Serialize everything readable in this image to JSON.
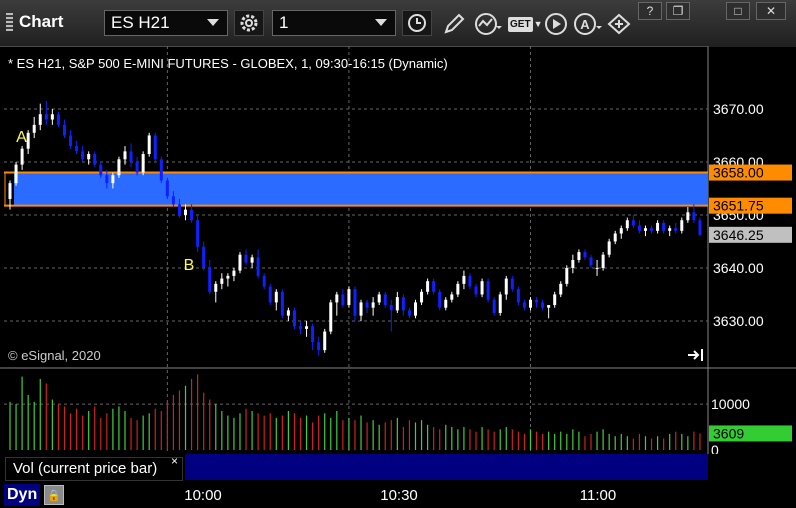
{
  "toolbar": {
    "title": "Chart",
    "symbol": "ES H21",
    "interval": "1",
    "icons": [
      "settings-gear-icon",
      "clock-icon",
      "pencil-icon",
      "study-icon",
      "get-icon",
      "play-icon",
      "analyst-icon",
      "dom-icon"
    ],
    "get_label": "GET",
    "window_buttons": [
      "link-icon",
      "restore-icon",
      "maximize-icon",
      "close-icon"
    ]
  },
  "chart_header": "* ES H21, S&P 500 E-MINI FUTURES - GLOBEX, 1, 09:30-16:15 (Dynamic)",
  "copyright": "© eSignal, 2020",
  "annotations": {
    "a": "A",
    "b": "B"
  },
  "price_axis": {
    "ticks": [
      "3670.00",
      "3660.00",
      "3650.00",
      "3640.00",
      "3630.00"
    ],
    "tick_values": [
      3670,
      3660,
      3650,
      3640,
      3630
    ],
    "markers": [
      {
        "label": "3658.00",
        "value": 3658.0,
        "color": "#ff8c00"
      },
      {
        "label": "3651.75",
        "value": 3651.75,
        "color": "#ff8c00"
      },
      {
        "label": "3646.25",
        "value": 3646.25,
        "color": "#c0c0c0"
      }
    ]
  },
  "zone": {
    "top": 3658.0,
    "bottom": 3651.75,
    "fill": "#2b6bff",
    "border": "#ff8c00"
  },
  "volume_axis": {
    "ticks": [
      "10000",
      "0"
    ],
    "tick_values": [
      10000,
      0
    ],
    "marker": {
      "label": "3609",
      "value": 3609,
      "color": "#33cc33"
    }
  },
  "vol_pane_label": "Vol (current price bar)",
  "vol_close": "×",
  "time_axis": {
    "ticks": [
      "10:00",
      "10:30",
      "11:00"
    ]
  },
  "bottom": {
    "dyn_label": "Dyn"
  },
  "colors": {
    "up": "#ffffff",
    "down": "#1020ff",
    "vol_up": "#44cc44",
    "vol_down": "#cc2222",
    "grid": "#666666"
  },
  "chart_data": {
    "type": "candlestick",
    "title": "* ES H21, S&P 500 E-MINI FUTURES - GLOBEX, 1, 09:30-16:15 (Dynamic)",
    "first_bar_time": "09:30",
    "interval_minutes": 1,
    "price_range": [
      3621.5,
      3681.5
    ],
    "volume_range": [
      0,
      17000
    ],
    "bars": [
      [
        3653.0,
        3656.5,
        3651.0,
        3656.0
      ],
      [
        3656.0,
        3660.0,
        3655.5,
        3659.5
      ],
      [
        3659.5,
        3663.0,
        3658.5,
        3662.5
      ],
      [
        3662.5,
        3666.0,
        3661.5,
        3665.5
      ],
      [
        3665.5,
        3668.5,
        3664.5,
        3667.0
      ],
      [
        3667.0,
        3671.0,
        3666.0,
        3669.0
      ],
      [
        3669.0,
        3671.5,
        3667.0,
        3668.0
      ],
      [
        3668.0,
        3670.0,
        3667.0,
        3669.0
      ],
      [
        3669.0,
        3669.5,
        3666.5,
        3667.0
      ],
      [
        3667.0,
        3668.0,
        3664.5,
        3665.0
      ],
      [
        3665.0,
        3666.0,
        3662.5,
        3663.0
      ],
      [
        3663.0,
        3664.0,
        3661.5,
        3662.0
      ],
      [
        3662.0,
        3663.0,
        3660.0,
        3660.5
      ],
      [
        3660.5,
        3662.0,
        3659.5,
        3661.5
      ],
      [
        3661.5,
        3662.0,
        3659.0,
        3659.5
      ],
      [
        3659.5,
        3660.0,
        3657.0,
        3657.5
      ],
      [
        3657.5,
        3658.5,
        3655.0,
        3656.0
      ],
      [
        3656.0,
        3658.0,
        3655.0,
        3657.5
      ],
      [
        3657.5,
        3661.0,
        3657.0,
        3660.5
      ],
      [
        3660.5,
        3663.0,
        3659.5,
        3662.0
      ],
      [
        3662.0,
        3663.5,
        3659.0,
        3660.0
      ],
      [
        3660.0,
        3661.0,
        3657.5,
        3658.0
      ],
      [
        3658.0,
        3662.0,
        3657.5,
        3661.5
      ],
      [
        3661.5,
        3665.5,
        3661.0,
        3665.0
      ],
      [
        3665.0,
        3665.5,
        3660.0,
        3660.5
      ],
      [
        3660.5,
        3661.0,
        3656.0,
        3656.5
      ],
      [
        3656.5,
        3657.0,
        3653.0,
        3653.5
      ],
      [
        3653.5,
        3654.5,
        3651.5,
        3652.0
      ],
      [
        3652.0,
        3653.0,
        3649.5,
        3650.0
      ],
      [
        3650.0,
        3652.0,
        3649.0,
        3651.0
      ],
      [
        3651.0,
        3652.0,
        3648.5,
        3649.0
      ],
      [
        3649.0,
        3650.0,
        3643.0,
        3644.0
      ],
      [
        3644.0,
        3645.0,
        3639.5,
        3640.0
      ],
      [
        3640.0,
        3641.5,
        3635.0,
        3635.5
      ],
      [
        3635.5,
        3637.5,
        3633.5,
        3637.0
      ],
      [
        3637.0,
        3639.0,
        3636.0,
        3638.0
      ],
      [
        3638.0,
        3639.0,
        3636.5,
        3638.5
      ],
      [
        3638.5,
        3640.0,
        3637.5,
        3639.5
      ],
      [
        3639.5,
        3643.0,
        3639.0,
        3642.5
      ],
      [
        3642.5,
        3643.5,
        3640.5,
        3641.0
      ],
      [
        3641.0,
        3642.5,
        3640.0,
        3642.0
      ],
      [
        3642.0,
        3643.5,
        3638.0,
        3638.5
      ],
      [
        3638.5,
        3639.0,
        3636.0,
        3636.5
      ],
      [
        3636.5,
        3637.0,
        3633.0,
        3633.5
      ],
      [
        3633.5,
        3636.0,
        3632.0,
        3635.5
      ],
      [
        3635.5,
        3636.0,
        3630.5,
        3631.0
      ],
      [
        3631.0,
        3632.5,
        3630.0,
        3632.0
      ],
      [
        3632.0,
        3632.5,
        3628.5,
        3629.0
      ],
      [
        3629.0,
        3630.0,
        3627.5,
        3628.5
      ],
      [
        3628.5,
        3630.0,
        3627.0,
        3629.0
      ],
      [
        3629.0,
        3629.5,
        3624.5,
        3626.0
      ],
      [
        3626.0,
        3627.0,
        3623.5,
        3624.5
      ],
      [
        3624.5,
        3628.5,
        3624.0,
        3628.0
      ],
      [
        3628.0,
        3634.0,
        3627.5,
        3633.5
      ],
      [
        3633.5,
        3635.5,
        3631.0,
        3635.0
      ],
      [
        3635.0,
        3636.0,
        3632.5,
        3633.0
      ],
      [
        3633.0,
        3636.5,
        3632.5,
        3636.0
      ],
      [
        3636.0,
        3636.5,
        3630.0,
        3631.0
      ],
      [
        3631.0,
        3634.0,
        3630.0,
        3633.5
      ],
      [
        3633.5,
        3634.0,
        3631.5,
        3632.5
      ],
      [
        3632.5,
        3634.5,
        3631.0,
        3633.5
      ],
      [
        3633.5,
        3635.5,
        3633.0,
        3635.0
      ],
      [
        3635.0,
        3635.5,
        3632.5,
        3633.0
      ],
      [
        3633.0,
        3634.0,
        3628.0,
        3632.0
      ],
      [
        3632.0,
        3635.5,
        3631.5,
        3634.5
      ],
      [
        3634.5,
        3635.0,
        3631.0,
        3632.0
      ],
      [
        3632.0,
        3632.5,
        3630.5,
        3631.0
      ],
      [
        3631.0,
        3634.0,
        3630.5,
        3633.5
      ],
      [
        3633.5,
        3636.0,
        3633.0,
        3635.5
      ],
      [
        3635.5,
        3638.0,
        3635.0,
        3637.5
      ],
      [
        3637.5,
        3638.0,
        3635.0,
        3635.5
      ],
      [
        3635.5,
        3636.0,
        3632.0,
        3632.5
      ],
      [
        3632.5,
        3634.5,
        3632.0,
        3634.0
      ],
      [
        3634.0,
        3635.5,
        3633.5,
        3635.0
      ],
      [
        3635.0,
        3637.5,
        3634.5,
        3637.0
      ],
      [
        3637.0,
        3639.5,
        3636.0,
        3638.5
      ],
      [
        3638.5,
        3639.0,
        3636.0,
        3636.5
      ],
      [
        3636.5,
        3637.0,
        3634.5,
        3635.0
      ],
      [
        3635.0,
        3638.0,
        3634.5,
        3637.5
      ],
      [
        3637.5,
        3638.0,
        3633.5,
        3634.0
      ],
      [
        3634.0,
        3634.5,
        3631.0,
        3631.5
      ],
      [
        3631.5,
        3635.5,
        3631.0,
        3635.0
      ],
      [
        3635.0,
        3638.5,
        3634.0,
        3638.0
      ],
      [
        3638.0,
        3638.5,
        3635.5,
        3636.0
      ],
      [
        3636.0,
        3636.5,
        3633.0,
        3633.5
      ],
      [
        3633.5,
        3634.0,
        3632.0,
        3632.5
      ],
      [
        3632.5,
        3634.5,
        3632.0,
        3634.0
      ],
      [
        3634.0,
        3634.5,
        3632.5,
        3633.5
      ],
      [
        3633.5,
        3634.0,
        3632.0,
        3632.5
      ],
      [
        3632.5,
        3633.0,
        3630.5,
        3633.0
      ],
      [
        3633.0,
        3635.5,
        3632.5,
        3635.0
      ],
      [
        3635.0,
        3637.5,
        3634.5,
        3637.0
      ],
      [
        3637.0,
        3640.5,
        3636.5,
        3640.0
      ],
      [
        3640.0,
        3642.5,
        3639.0,
        3641.5
      ],
      [
        3641.5,
        3643.5,
        3641.0,
        3643.0
      ],
      [
        3643.0,
        3643.5,
        3641.5,
        3642.0
      ],
      [
        3642.0,
        3642.5,
        3640.0,
        3640.5
      ],
      [
        3640.0,
        3641.5,
        3638.5,
        3640.0
      ],
      [
        3640.0,
        3643.0,
        3639.5,
        3642.5
      ],
      [
        3642.5,
        3645.5,
        3642.0,
        3645.0
      ],
      [
        3645.0,
        3647.0,
        3644.5,
        3646.5
      ],
      [
        3646.5,
        3648.0,
        3645.5,
        3647.5
      ],
      [
        3647.5,
        3649.5,
        3647.0,
        3649.0
      ],
      [
        3649.0,
        3650.0,
        3647.5,
        3648.0
      ],
      [
        3648.0,
        3649.0,
        3646.5,
        3647.0
      ],
      [
        3647.0,
        3648.0,
        3646.0,
        3647.5
      ],
      [
        3647.5,
        3648.0,
        3646.5,
        3647.0
      ],
      [
        3647.0,
        3649.0,
        3646.5,
        3648.5
      ],
      [
        3648.5,
        3649.0,
        3646.5,
        3647.0
      ],
      [
        3647.0,
        3648.0,
        3646.0,
        3647.5
      ],
      [
        3647.5,
        3648.5,
        3646.5,
        3647.0
      ],
      [
        3647.0,
        3649.5,
        3646.5,
        3649.0
      ],
      [
        3649.0,
        3651.5,
        3648.5,
        3650.5
      ],
      [
        3650.5,
        3652.0,
        3648.5,
        3649.0
      ],
      [
        3649.0,
        3649.5,
        3646.0,
        3646.25
      ]
    ],
    "volume": [
      10500,
      10000,
      16000,
      12000,
      10500,
      15500,
      14500,
      11000,
      10000,
      9500,
      8000,
      9000,
      7500,
      8500,
      9500,
      7000,
      8000,
      9000,
      9500,
      8500,
      7000,
      6500,
      7500,
      8000,
      9000,
      8500,
      10500,
      12000,
      13000,
      14000,
      15500,
      16500,
      12500,
      11000,
      10000,
      8500,
      7500,
      7000,
      8000,
      9000,
      8500,
      8000,
      7500,
      8000,
      7000,
      7500,
      8500,
      8000,
      7000,
      7500,
      6000,
      7500,
      8000,
      7000,
      8500,
      6500,
      7000,
      6500,
      7500,
      6000,
      6500,
      5500,
      6000,
      6500,
      7000,
      5000,
      6500,
      6000,
      6500,
      5500,
      5000,
      4500,
      5500,
      5000,
      4500,
      5000,
      4500,
      4000,
      5000,
      4500,
      4000,
      4500,
      5000,
      4500,
      4000,
      3500,
      4500,
      4000,
      3500,
      4000,
      3500,
      4000,
      3500,
      4500,
      4000,
      3000,
      3500,
      4000,
      4500,
      3500,
      3000,
      3500,
      3000,
      2500,
      3500,
      3000,
      2500,
      3000,
      2500,
      3500,
      4000,
      3500,
      3000,
      4000,
      3609
    ]
  }
}
